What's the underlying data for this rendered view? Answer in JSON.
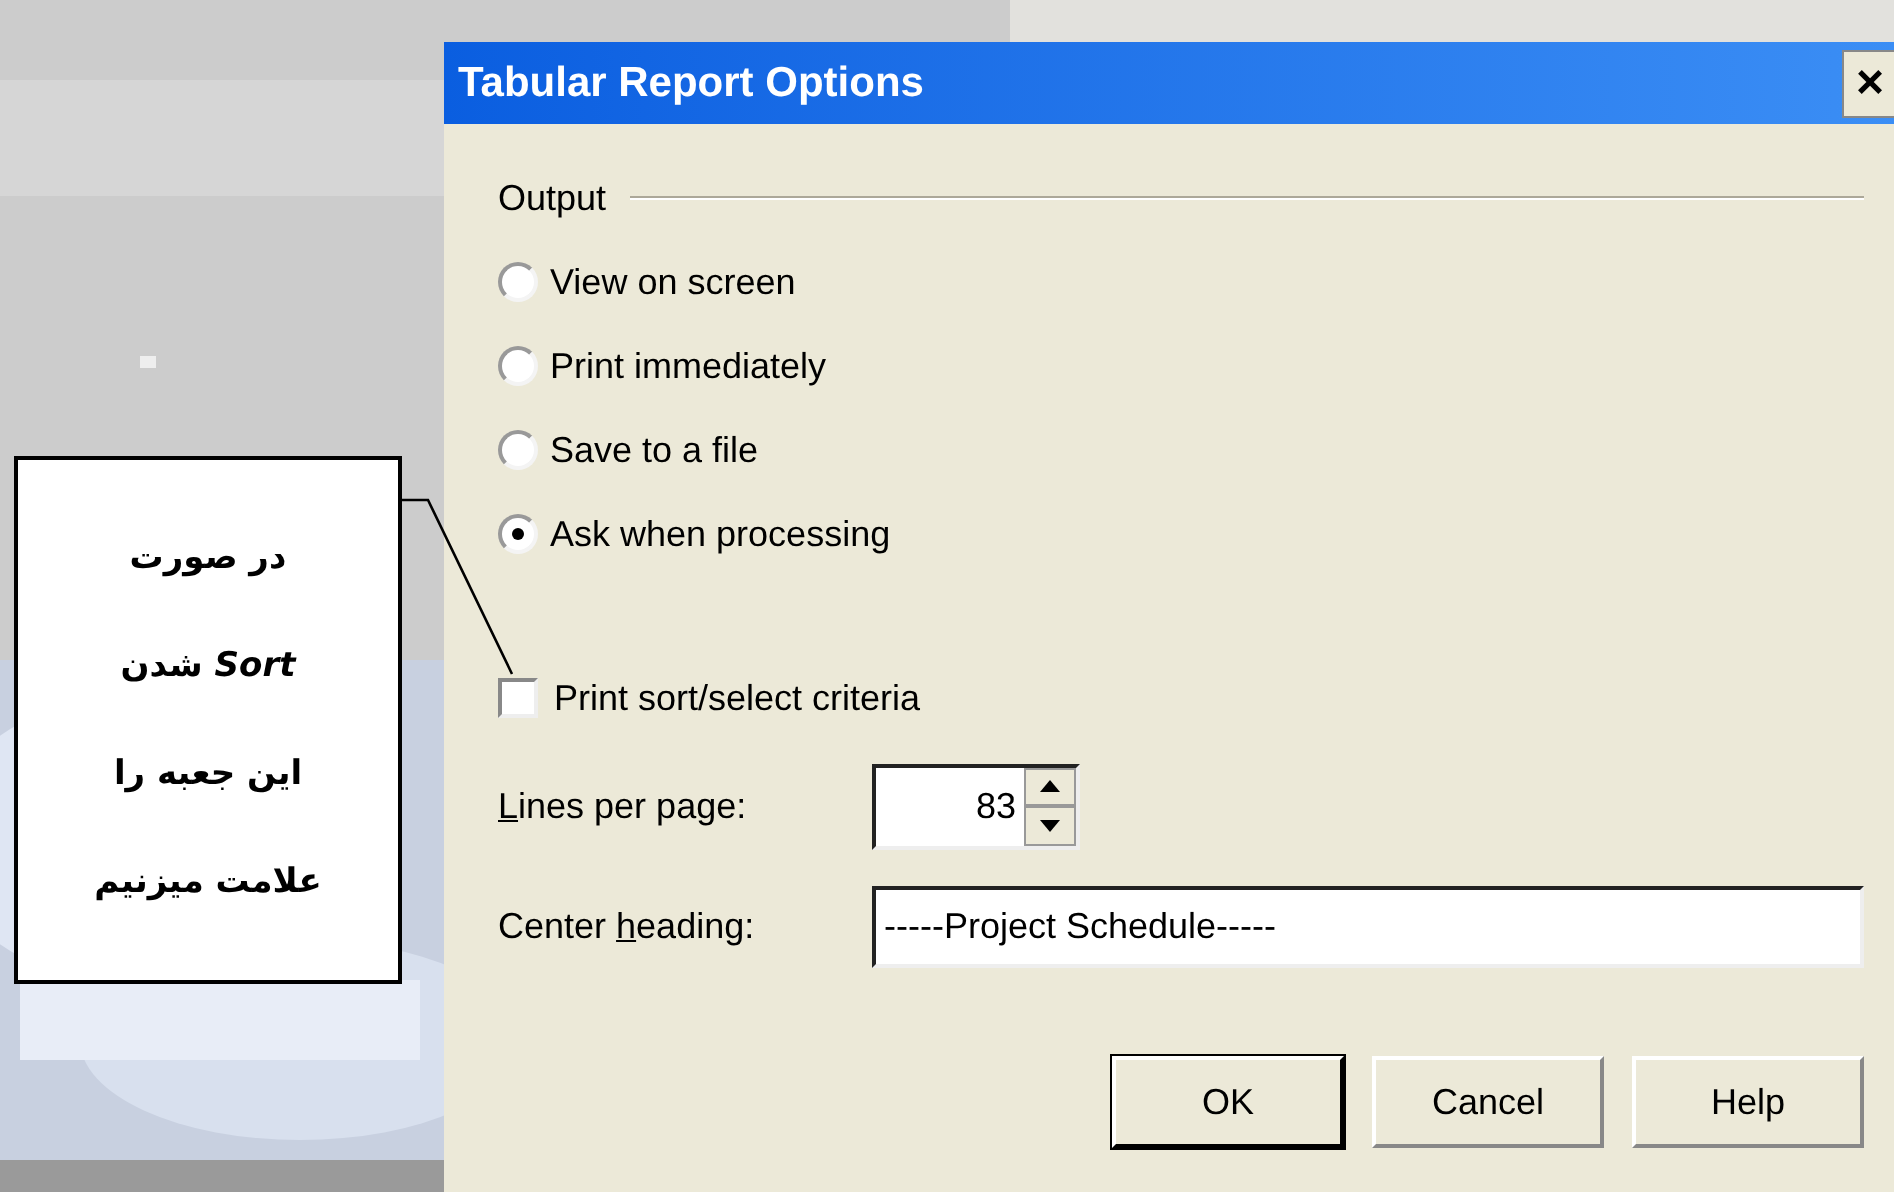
{
  "callout": {
    "text": "در صورت *Sort* شدن این جعبه را علامت میزنیم"
  },
  "dialog": {
    "title": "Tabular Report Options",
    "close": "×",
    "output_group": {
      "label": "Output",
      "options": [
        {
          "label": "View on screen",
          "selected": false
        },
        {
          "label": "Print immediately",
          "selected": false
        },
        {
          "label": "Save to a file",
          "selected": false
        },
        {
          "label": "Ask when processing",
          "selected": true
        }
      ]
    },
    "print_criteria": {
      "label": "Print sort/select criteria",
      "checked": false
    },
    "lines_per_page": {
      "label": {
        "key": "L",
        "after": "ines per page:"
      },
      "value": "83"
    },
    "center_heading": {
      "label": {
        "before": "Center ",
        "key": "h",
        "after": "eading:"
      },
      "value": "-----Project Schedule-----"
    },
    "buttons": [
      {
        "label": "OK",
        "default": true
      },
      {
        "label": "Cancel",
        "default": false
      },
      {
        "label": "Help",
        "default": false
      }
    ]
  }
}
